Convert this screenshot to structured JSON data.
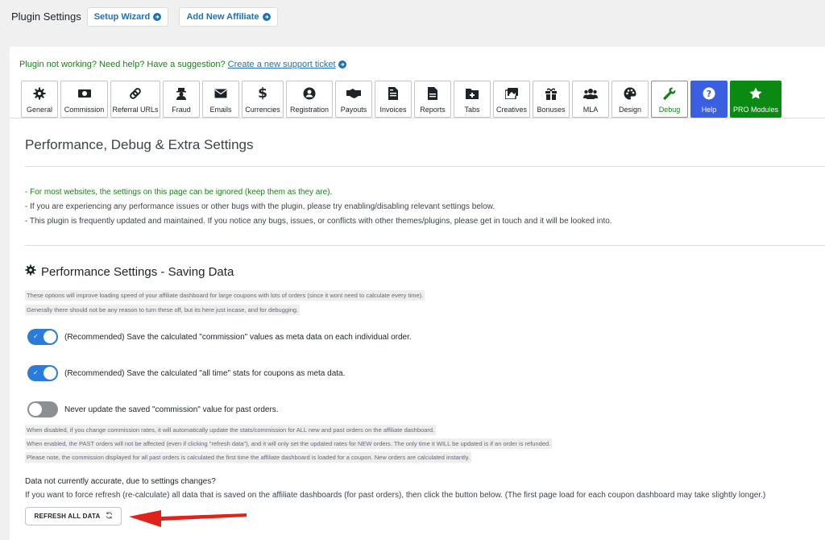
{
  "header": {
    "title": "Plugin Settings",
    "setup_wizard": "Setup Wizard",
    "add_affiliate": "Add New Affiliate"
  },
  "help": {
    "text": "Plugin not working? Need help? Have a suggestion?",
    "link": "Create a new support ticket"
  },
  "tabs": [
    {
      "label": "General",
      "icon": "gear-icon"
    },
    {
      "label": "Commission",
      "icon": "money-icon"
    },
    {
      "label": "Referral URLs",
      "icon": "link-icon"
    },
    {
      "label": "Fraud",
      "icon": "user-secret-icon"
    },
    {
      "label": "Emails",
      "icon": "envelope-icon"
    },
    {
      "label": "Currencies",
      "icon": "dollar-icon"
    },
    {
      "label": "Registration",
      "icon": "user-circle-icon"
    },
    {
      "label": "Payouts",
      "icon": "handshake-icon"
    },
    {
      "label": "Invoices",
      "icon": "invoice-icon"
    },
    {
      "label": "Reports",
      "icon": "file-icon"
    },
    {
      "label": "Tabs",
      "icon": "folder-plus-icon"
    },
    {
      "label": "Creatives",
      "icon": "images-icon"
    },
    {
      "label": "Bonuses",
      "icon": "gift-icon"
    },
    {
      "label": "MLA",
      "icon": "users-icon"
    },
    {
      "label": "Design",
      "icon": "palette-icon"
    },
    {
      "label": "Debug",
      "icon": "wrench-icon"
    },
    {
      "label": "Help",
      "icon": "question-circle-icon"
    },
    {
      "label": "PRO Modules",
      "icon": "star-icon"
    }
  ],
  "section_title": "Performance, Debug & Extra Settings",
  "notes": {
    "line1": "- For most websites, the settings on this page can be ignored (keep them as they are).",
    "line2": "- If you are experiencing any performance issues or other bugs with the plugin, please try enabling/disabling relevant settings below.",
    "line3": "- This plugin is frequently updated and maintained. If you notice any bugs, issues, or conflicts with other themes/plugins, please get in touch and it will be looked into."
  },
  "performance": {
    "title": "Performance Settings - Saving Data",
    "desc1": "These options will improve loading speed of your affiliate dashboard for large coupons with lots of orders (since it wont need to calculate every time).",
    "desc2": "Generally there should not be any reason to turn these off, but its here just incase, and for debugging.",
    "toggle1": {
      "label": "(Recommended) Save the calculated \"commission\" values as meta data on each individual order.",
      "on": true
    },
    "toggle2": {
      "label": "(Recommended) Save the calculated \"all time\" stats for coupons as meta data.",
      "on": true
    },
    "toggle3": {
      "label": "Never update the saved \"commission\" value for past orders.",
      "on": false
    },
    "note1": "When disabled, if you change commission rates, it will automatically update the stats/commission for ALL new and past orders on the affiliate dashboard.",
    "note2": "When enabled, the PAST orders will not be affected (even if clicking \"refresh data\"), and it will only set the updated rates for NEW orders. The only time it WILL be updated is if an order is refunded.",
    "note3": "Please note, the commission displayed for all past orders is calculated the first time the affiliate dashboard is loaded for a coupon. New orders are calculated instantly."
  },
  "accuracy": {
    "question": "Data not currently accurate, due to settings changes?",
    "desc": "If you want to force refresh (re-calculate) all data that is saved on the affiliate dashboards (for past orders), then click the button below. (The first page load for each coupon dashboard may take slightly longer.)",
    "button": "REFRESH ALL DATA"
  },
  "colors": {
    "accent": "#2271b1",
    "green": "#1a7f1a",
    "help_tab": "#3a5fe0",
    "pro_tab": "#0a8a12",
    "toggle_on": "#2a7cdc",
    "arrow": "#e0221b"
  }
}
